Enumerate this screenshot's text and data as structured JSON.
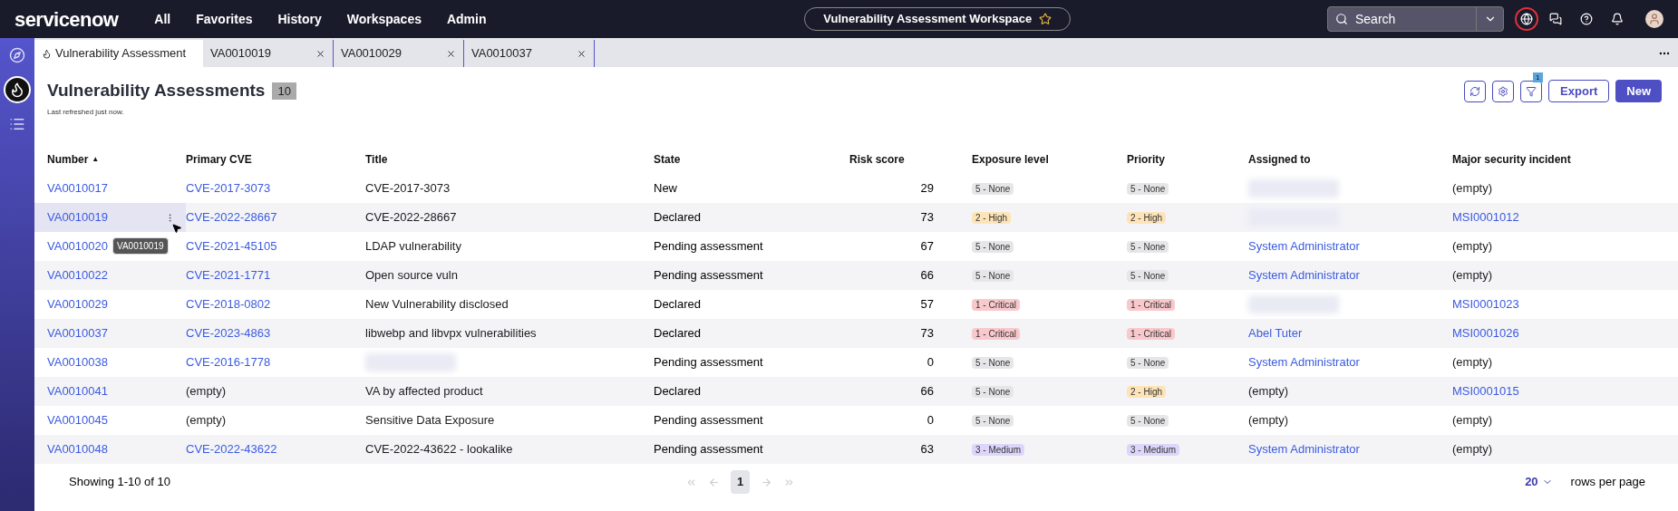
{
  "top_bar": {
    "logo": "servicenow",
    "nav": [
      "All",
      "Favorites",
      "History",
      "Workspaces",
      "Admin"
    ],
    "workspace_title": "Vulnerability Assessment Workspace",
    "search": {
      "placeholder": "Search"
    }
  },
  "sidebar": {
    "items": [
      {
        "kind": "compass",
        "selected": false
      },
      {
        "kind": "flame",
        "selected": true
      },
      {
        "kind": "list",
        "selected": false
      }
    ]
  },
  "tabs": [
    {
      "label": "Vulnerability Assessment",
      "selected": true,
      "closable": false
    },
    {
      "label": "VA0010019",
      "selected": false,
      "closable": true
    },
    {
      "label": "VA0010029",
      "selected": false,
      "closable": true
    },
    {
      "label": "VA0010037",
      "selected": false,
      "closable": true
    }
  ],
  "header": {
    "title": "Vulnerability Assessments",
    "count": "10",
    "subtitle": "Last refreshed just now.",
    "filter_count": "1",
    "buttons": [
      "Export",
      "New"
    ]
  },
  "table": {
    "columns": [
      {
        "label": "Number",
        "sort_icon": "▲"
      },
      {
        "label": "Primary CVE"
      },
      {
        "label": "Title"
      },
      {
        "label": "State"
      },
      {
        "label": "Risk score"
      },
      {
        "label": "Exposure level"
      },
      {
        "label": "Priority"
      },
      {
        "label": "Assigned to"
      },
      {
        "label": "Major security incident"
      }
    ],
    "rows": [
      {
        "number": "VA0010017",
        "hovered": false,
        "cve": {
          "text": "CVE-2017-3073",
          "kind": "link"
        },
        "title": {
          "text": "CVE-2017-3073",
          "kind": "plain"
        },
        "state": "New",
        "risk": "29",
        "exposure": {
          "text": "5 - None",
          "color": "#e6e6e8"
        },
        "priority": {
          "text": "5 - None",
          "color": "#e6e6e8"
        },
        "assigned": {
          "kind": "redacted"
        },
        "incident": {
          "text": "(empty)",
          "kind": "plain"
        }
      },
      {
        "number": "VA0010019",
        "hovered": true,
        "cve": {
          "text": "CVE-2022-28667",
          "kind": "link"
        },
        "title": {
          "text": "CVE-2022-28667",
          "kind": "plain"
        },
        "state": "Declared",
        "risk": "73",
        "exposure": {
          "text": "2 - High",
          "color": "#fde4b8"
        },
        "priority": {
          "text": "2 - High",
          "color": "#fde4b8"
        },
        "assigned": {
          "kind": "redacted"
        },
        "incident": {
          "text": "MSI0001012",
          "kind": "link"
        }
      },
      {
        "number": "VA0010020",
        "hovered": false,
        "cve": {
          "text": "CVE-2021-45105",
          "kind": "link"
        },
        "title": {
          "text": "LDAP vulnerability",
          "kind": "plain"
        },
        "state": "Pending assessment",
        "risk": "67",
        "exposure": {
          "text": "5 - None",
          "color": "#e6e6e8"
        },
        "priority": {
          "text": "5 - None",
          "color": "#e6e6e8"
        },
        "assigned": {
          "text": "System Administrator",
          "kind": "link"
        },
        "incident": {
          "text": "(empty)",
          "kind": "plain"
        }
      },
      {
        "number": "VA0010022",
        "hovered": false,
        "cve": {
          "text": "CVE-2021-1771",
          "kind": "link"
        },
        "title": {
          "text": "Open source vuln",
          "kind": "plain"
        },
        "state": "Pending assessment",
        "risk": "66",
        "exposure": {
          "text": "5 - None",
          "color": "#e6e6e8"
        },
        "priority": {
          "text": "5 - None",
          "color": "#e6e6e8"
        },
        "assigned": {
          "text": "System Administrator",
          "kind": "link"
        },
        "incident": {
          "text": "(empty)",
          "kind": "plain"
        }
      },
      {
        "number": "VA0010029",
        "hovered": false,
        "cve": {
          "text": "CVE-2018-0802",
          "kind": "link"
        },
        "title": {
          "text": "New Vulnerability disclosed",
          "kind": "plain"
        },
        "state": "Declared",
        "risk": "57",
        "exposure": {
          "text": "1 - Critical",
          "color": "#f8c8cc"
        },
        "priority": {
          "text": "1 - Critical",
          "color": "#f8c8cc"
        },
        "assigned": {
          "kind": "redacted"
        },
        "incident": {
          "text": "MSI0001023",
          "kind": "link"
        }
      },
      {
        "number": "VA0010037",
        "hovered": false,
        "cve": {
          "text": "CVE-2023-4863",
          "kind": "link"
        },
        "title": {
          "text": "libwebp and libvpx vulnerabilities",
          "kind": "plain"
        },
        "state": "Declared",
        "risk": "73",
        "exposure": {
          "text": "1 - Critical",
          "color": "#f8c8cc"
        },
        "priority": {
          "text": "1 - Critical",
          "color": "#f8c8cc"
        },
        "assigned": {
          "text": "Abel Tuter",
          "kind": "link"
        },
        "incident": {
          "text": "MSI0001026",
          "kind": "link"
        }
      },
      {
        "number": "VA0010038",
        "hovered": false,
        "cve": {
          "text": "CVE-2016-1778",
          "kind": "link"
        },
        "title": {
          "kind": "redacted"
        },
        "state": "Pending assessment",
        "risk": "0",
        "exposure": {
          "text": "5 - None",
          "color": "#e6e6e8"
        },
        "priority": {
          "text": "5 - None",
          "color": "#e6e6e8"
        },
        "assigned": {
          "text": "System Administrator",
          "kind": "link"
        },
        "incident": {
          "text": "(empty)",
          "kind": "plain"
        }
      },
      {
        "number": "VA0010041",
        "hovered": false,
        "cve": {
          "text": "(empty)",
          "kind": "plain"
        },
        "title": {
          "text": "VA by affected product",
          "kind": "plain"
        },
        "state": "Declared",
        "risk": "66",
        "exposure": {
          "text": "5 - None",
          "color": "#e6e6e8"
        },
        "priority": {
          "text": "2 - High",
          "color": "#fde4b8"
        },
        "assigned": {
          "text": "(empty)",
          "kind": "plain"
        },
        "incident": {
          "text": "MSI0001015",
          "kind": "link"
        }
      },
      {
        "number": "VA0010045",
        "hovered": false,
        "cve": {
          "text": "(empty)",
          "kind": "plain"
        },
        "title": {
          "text": "Sensitive Data Exposure",
          "kind": "plain"
        },
        "state": "Pending assessment",
        "risk": "0",
        "exposure": {
          "text": "5 - None",
          "color": "#e6e6e8"
        },
        "priority": {
          "text": "5 - None",
          "color": "#e6e6e8"
        },
        "assigned": {
          "text": "(empty)",
          "kind": "plain"
        },
        "incident": {
          "text": "(empty)",
          "kind": "plain"
        }
      },
      {
        "number": "VA0010048",
        "hovered": false,
        "cve": {
          "text": "CVE-2022-43622",
          "kind": "link"
        },
        "title": {
          "text": "CVE-2022-43622 - lookalike",
          "kind": "plain"
        },
        "state": "Pending assessment",
        "risk": "63",
        "exposure": {
          "text": "3 - Medium",
          "color": "#ddd5fa"
        },
        "priority": {
          "text": "3 - Medium",
          "color": "#ddd5fa"
        },
        "assigned": {
          "text": "System Administrator",
          "kind": "link"
        },
        "incident": {
          "text": "(empty)",
          "kind": "plain"
        }
      }
    ],
    "tooltip": {
      "text": "VA0010019"
    }
  },
  "footer": {
    "summary": "Showing 1-10 of 10",
    "page": "1",
    "page_size": "20",
    "page_size_label": "rows per page"
  }
}
